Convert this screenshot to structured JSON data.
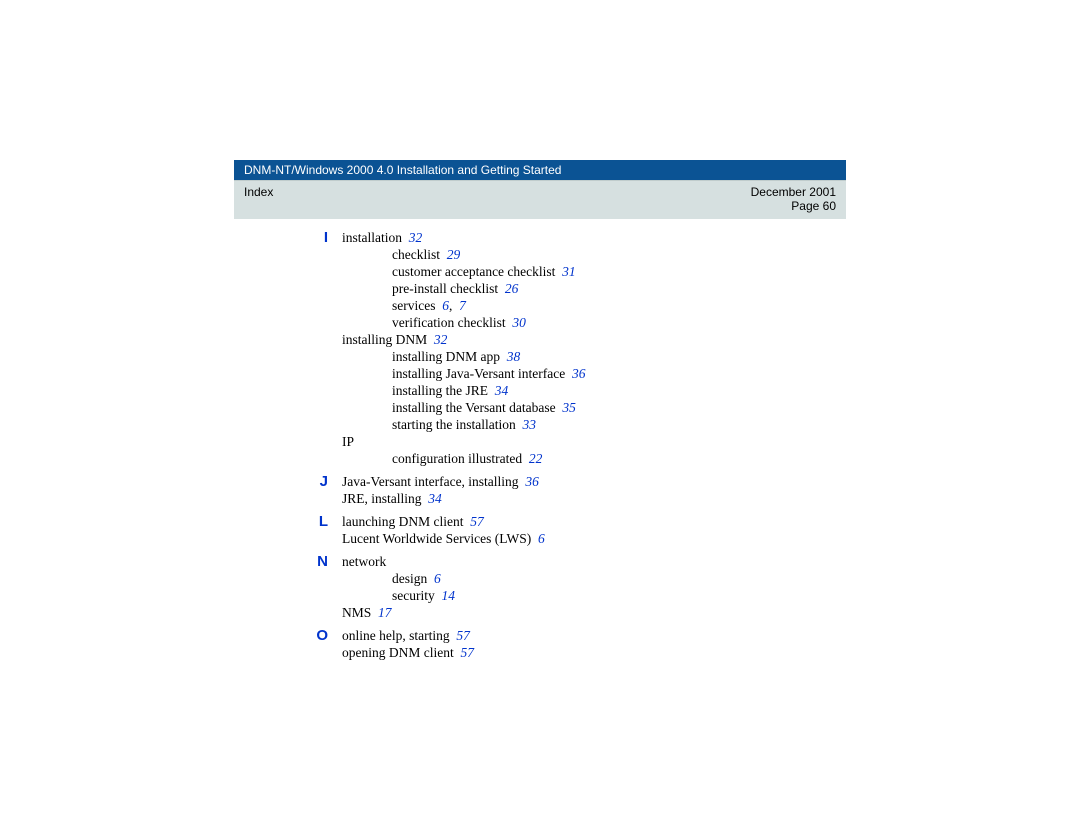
{
  "header": {
    "title": "DNM-NT/Windows 2000 4.0 Installation and Getting Started",
    "left": "Index",
    "date": "December 2001",
    "page": "Page 60"
  },
  "sections": {
    "I": {
      "letter": "I",
      "l1": {
        "t": "installation",
        "p": "32"
      },
      "l2": {
        "t": "checklist",
        "p": "29"
      },
      "l3": {
        "t": "customer acceptance checklist",
        "p": "31"
      },
      "l4": {
        "t": "pre-install checklist",
        "p": "26"
      },
      "l5": {
        "t": "services",
        "p1": "6",
        "sep": ",",
        "p2": "7"
      },
      "l6": {
        "t": "verification checklist",
        "p": "30"
      },
      "l7": {
        "t": "installing DNM",
        "p": "32"
      },
      "l8": {
        "t": "installing DNM app",
        "p": "38"
      },
      "l9": {
        "t": "installing Java-Versant interface",
        "p": "36"
      },
      "l10": {
        "t": "installing the JRE",
        "p": "34"
      },
      "l11": {
        "t": "installing the Versant database",
        "p": "35"
      },
      "l12": {
        "t": "starting the installation",
        "p": "33"
      },
      "l13": {
        "t": "IP"
      },
      "l14": {
        "t": "configuration illustrated",
        "p": "22"
      }
    },
    "J": {
      "letter": "J",
      "l1": {
        "t": "Java-Versant interface, installing",
        "p": "36"
      },
      "l2": {
        "t": "JRE, installing",
        "p": "34"
      }
    },
    "L": {
      "letter": "L",
      "l1": {
        "t": "launching DNM client",
        "p": "57"
      },
      "l2": {
        "t": "Lucent Worldwide Services (LWS)",
        "p": "6"
      }
    },
    "N": {
      "letter": "N",
      "l1": {
        "t": "network"
      },
      "l2": {
        "t": "design",
        "p": "6"
      },
      "l3": {
        "t": "security",
        "p": "14"
      },
      "l4": {
        "t": "NMS",
        "p": "17"
      }
    },
    "O": {
      "letter": "O",
      "l1": {
        "t": "online help, starting",
        "p": "57"
      },
      "l2": {
        "t": "opening DNM client",
        "p": "57"
      }
    }
  }
}
